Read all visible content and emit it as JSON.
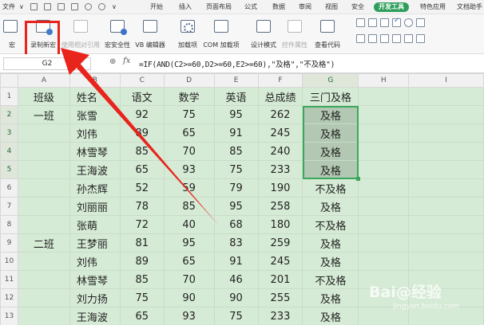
{
  "menubar": {
    "file": "文件",
    "tabs": [
      "开始",
      "插入",
      "页面布局",
      "公式",
      "数据",
      "审阅",
      "视图",
      "安全",
      "开发工具",
      "特色应用",
      "文档助手"
    ]
  },
  "ribbon": {
    "macro_partial": "宏",
    "record_macro": "录制新宏",
    "relative_ref": "使用相对引用",
    "macro_security": "宏安全性",
    "vb_editor": "VB 编辑器",
    "addins": "加载项",
    "com_addins": "COM 加载项",
    "design_mode": "设计模式",
    "control_props": "控件属性",
    "view_code": "查看代码"
  },
  "formula_bar": {
    "cell_ref": "G2",
    "zoom_glyph": "⊕",
    "fx": "fx",
    "formula": "=IF(AND(C2>=60,D2>=60,E2>=60),\"及格\",\"不及格\")"
  },
  "sheet": {
    "columns": [
      "A",
      "B",
      "C",
      "D",
      "E",
      "F",
      "G",
      "H",
      "I"
    ],
    "rows": [
      {
        "n": "1",
        "cells": [
          "班级",
          "姓名",
          "语文",
          "数学",
          "英语",
          "总成绩",
          "三门及格",
          "",
          ""
        ]
      },
      {
        "n": "2",
        "cells": [
          "一班",
          "张雪",
          "92",
          "75",
          "95",
          "262",
          "及格",
          "",
          ""
        ]
      },
      {
        "n": "3",
        "cells": [
          "",
          "刘伟",
          "89",
          "65",
          "91",
          "245",
          "及格",
          "",
          ""
        ]
      },
      {
        "n": "4",
        "cells": [
          "",
          "林雪琴",
          "85",
          "70",
          "85",
          "240",
          "及格",
          "",
          ""
        ]
      },
      {
        "n": "5",
        "cells": [
          "",
          "王海波",
          "65",
          "93",
          "75",
          "233",
          "及格",
          "",
          ""
        ]
      },
      {
        "n": "6",
        "cells": [
          "",
          "孙杰辉",
          "52",
          "59",
          "79",
          "190",
          "不及格",
          "",
          ""
        ]
      },
      {
        "n": "7",
        "cells": [
          "",
          "刘丽丽",
          "78",
          "85",
          "95",
          "258",
          "及格",
          "",
          ""
        ]
      },
      {
        "n": "8",
        "cells": [
          "",
          "张萌",
          "72",
          "40",
          "68",
          "180",
          "不及格",
          "",
          ""
        ]
      },
      {
        "n": "9",
        "cells": [
          "二班",
          "王梦丽",
          "81",
          "95",
          "83",
          "259",
          "及格",
          "",
          ""
        ]
      },
      {
        "n": "10",
        "cells": [
          "",
          "刘伟",
          "89",
          "65",
          "91",
          "245",
          "及格",
          "",
          ""
        ]
      },
      {
        "n": "11",
        "cells": [
          "",
          "林雪琴",
          "85",
          "70",
          "46",
          "201",
          "不及格",
          "",
          ""
        ]
      },
      {
        "n": "12",
        "cells": [
          "",
          "刘力扬",
          "75",
          "90",
          "90",
          "255",
          "及格",
          "",
          ""
        ]
      },
      {
        "n": "13",
        "cells": [
          "",
          "王海波",
          "65",
          "93",
          "75",
          "233",
          "及格",
          "",
          ""
        ]
      }
    ]
  },
  "watermark": {
    "main": "Bai@经验",
    "sub": "jingyan.baidu.com"
  },
  "colors": {
    "accent_green": "#2f9e5c",
    "cell_fill": "#d6ebd6",
    "selection_fill": "#b3c8b3",
    "annotation_red": "#e8241c"
  }
}
